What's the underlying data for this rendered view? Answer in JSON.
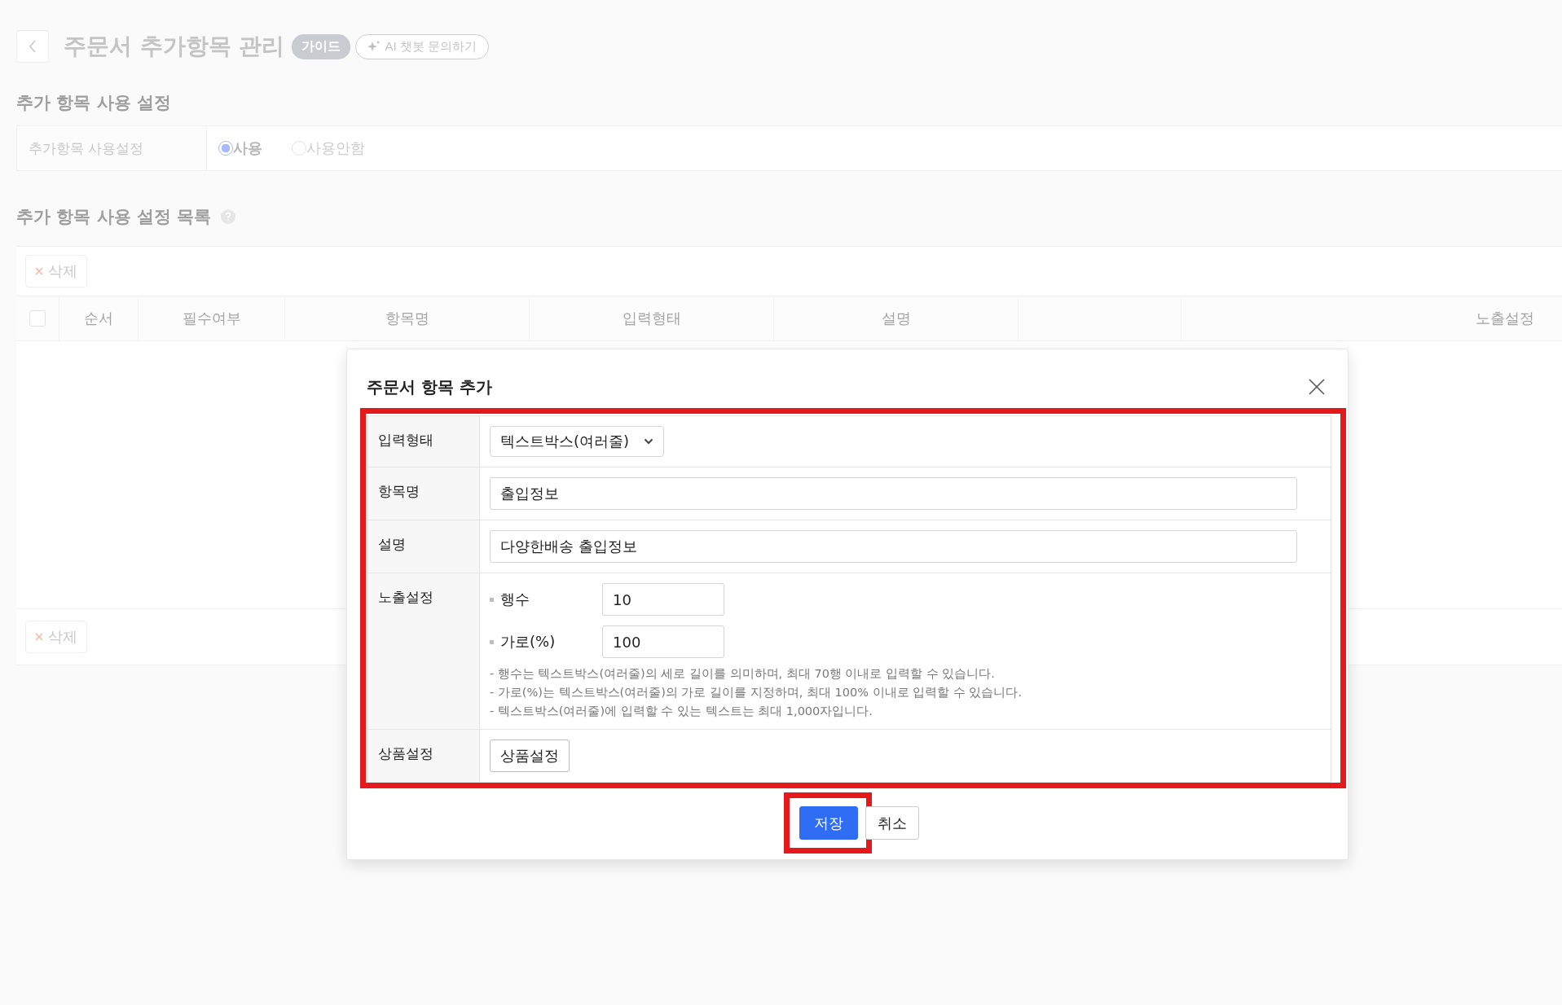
{
  "page": {
    "title": "주문서 추가항목 관리",
    "guide_badge": "가이드",
    "ai_button": "AI 챗봇 문의하기"
  },
  "usage_section": {
    "heading": "추가 항목 사용 설정",
    "label": "추가항목 사용설정",
    "options": [
      {
        "label": "사용",
        "selected": true
      },
      {
        "label": "사용안함",
        "selected": false
      }
    ]
  },
  "list_section": {
    "heading": "추가 항목 사용 설정 목록",
    "delete_buttons": [
      "삭제",
      "삭제"
    ],
    "table": {
      "select_all_checked": false,
      "columns": [
        "순서",
        "필수여부",
        "항목명",
        "입력형태",
        "설명",
        "노출설정"
      ]
    }
  },
  "modal": {
    "title": "주문서 항목 추가",
    "highlighted": true,
    "rows": [
      {
        "kind": "select",
        "label": "입력형태",
        "value": "텍스트박스(여러줄)"
      },
      {
        "kind": "text",
        "label": "항목명",
        "value": "출입정보"
      },
      {
        "kind": "text",
        "label": "설명",
        "value": "다양한배송 출입정보"
      },
      {
        "kind": "display",
        "label": "노출설정",
        "fields": [
          {
            "label": "행수",
            "value": "10"
          },
          {
            "label": "가로(%)",
            "value": "100"
          }
        ],
        "notes": [
          "- 행수는 텍스트박스(여러줄)의 세로 길이를 의미하며, 최대 70행 이내로 입력할 수 있습니다.",
          "- 가로(%)는 텍스트박스(여러줄)의 가로 길이를 지정하며, 최대 100% 이내로 입력할 수 있습니다.",
          "- 텍스트박스(여러줄)에 입력할 수 있는 텍스트는 최대 1,000자입니다."
        ]
      },
      {
        "kind": "button",
        "label": "상품설정",
        "button": "상품설정"
      }
    ],
    "buttons": [
      {
        "label": "저장",
        "kind": "primary",
        "highlighted": true
      },
      {
        "label": "취소",
        "kind": "secondary",
        "highlighted": false
      }
    ]
  }
}
